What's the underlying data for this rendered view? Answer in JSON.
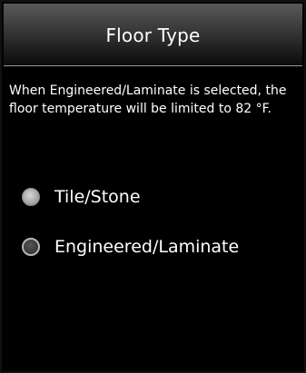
{
  "header": {
    "title": "Floor Type"
  },
  "message": "When Engineered/Laminate is selected, the floor temperature will be limited to 82 °F.",
  "options": [
    {
      "label": "Tile/Stone",
      "selected": true,
      "icon": "radio-selected-icon"
    },
    {
      "label": "Engineered/Laminate",
      "selected": false,
      "icon": "radio-unselected-icon"
    }
  ],
  "colors": {
    "background": "#000000",
    "text": "#ffffff",
    "header_top": "#5a5a5a",
    "header_bottom": "#0b0b0b",
    "radio_selected": "#a9a9a9",
    "radio_unselected": "#3c3c3c"
  }
}
